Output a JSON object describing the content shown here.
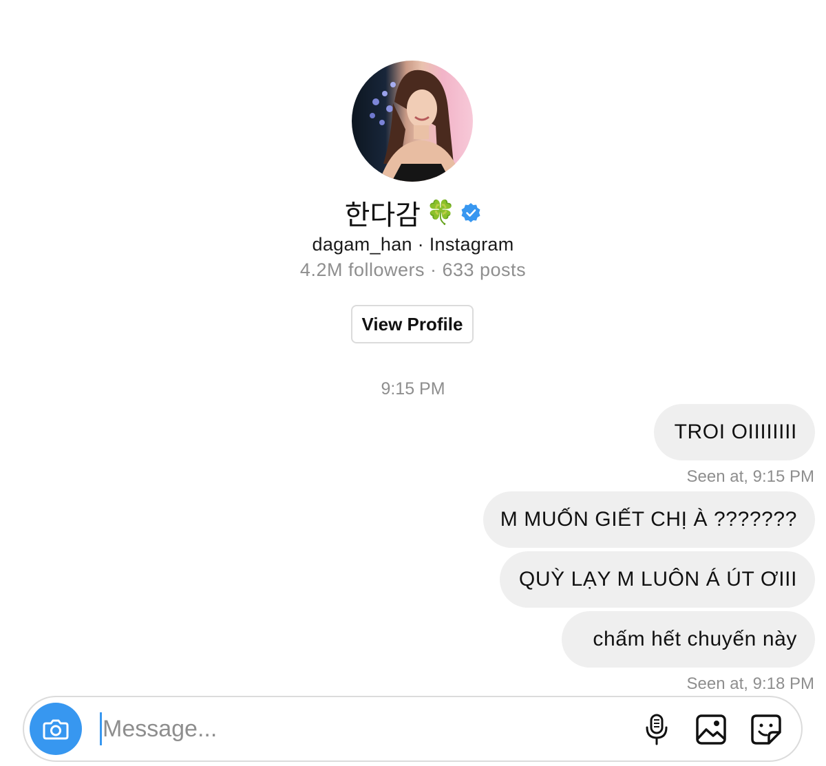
{
  "profile": {
    "name": "한다감",
    "name_emoji": "🍀",
    "verified": true,
    "handle_line": "dagam_han · Instagram",
    "stats_line": "4.2M followers · 633 posts",
    "view_profile_label": "View Profile"
  },
  "thread": {
    "timestamp": "9:15 PM",
    "messages": [
      {
        "text": "TROI OIIIIIIII",
        "sender": "me"
      },
      {
        "text": "M MUỐN GIẾT CHỊ À ???????",
        "sender": "me"
      },
      {
        "text": "QUỲ LẠY M LUÔN Á ÚT ƠIII",
        "sender": "me"
      },
      {
        "text": "chấm hết chuyến này",
        "sender": "me"
      }
    ],
    "seen_receipts": [
      "Seen at, 9:15 PM",
      "Seen at, 9:18 PM"
    ]
  },
  "composer": {
    "placeholder": "Message...",
    "value": "",
    "icons": [
      "camera-icon",
      "microphone-icon",
      "gallery-icon",
      "sticker-icon"
    ]
  },
  "colors": {
    "accent": "#3797f0",
    "bubble_bg": "#efefef",
    "muted_text": "#8e8e8e",
    "border": "#dbdbdb",
    "verified_badge": "#3897f0"
  }
}
